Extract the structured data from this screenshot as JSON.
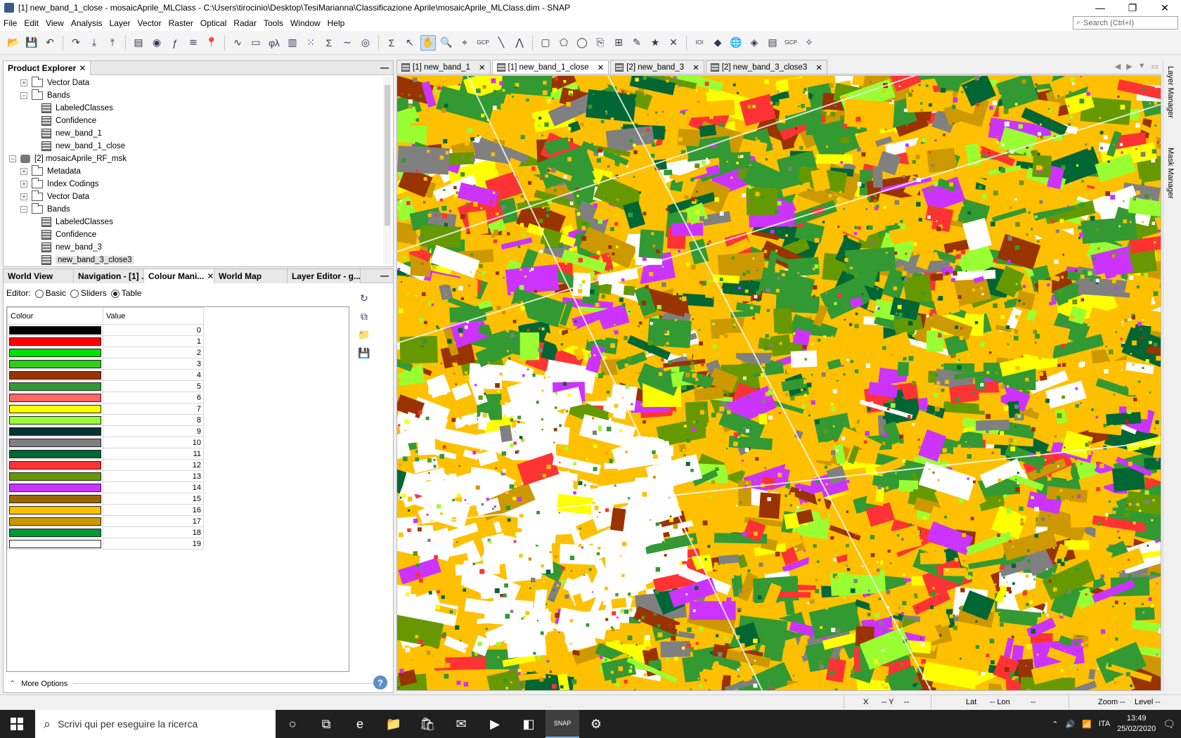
{
  "window": {
    "title": "[1] new_band_1_close - mosaicAprile_MLClass - C:\\Users\\tirocinio\\Desktop\\TesiMarianna\\Classificazione Aprile\\mosaicAprile_MLClass.dim - SNAP",
    "minimize_glyph": "—",
    "restore_glyph": "❐",
    "close_glyph": "✕"
  },
  "menu": [
    "File",
    "Edit",
    "View",
    "Analysis",
    "Layer",
    "Vector",
    "Raster",
    "Optical",
    "Radar",
    "Tools",
    "Window",
    "Help"
  ],
  "search": {
    "placeholder": "Search (Ctrl+I)"
  },
  "toolbar": {
    "icons": [
      "open-product-icon",
      "save-product-icon",
      "undo-icon",
      "redo-icon",
      "import-icon",
      "export-icon",
      "session-icon",
      "spectrum-view-icon",
      "band-maths-icon",
      "filter-icon",
      "pin-icon",
      "time-series-icon",
      "plot-icon",
      "phi-lambda-icon",
      "histogram-icon",
      "scatter-icon",
      "stats-icon",
      "profile-icon",
      "correlative-icon",
      "sum-icon",
      "select-tool-icon",
      "pan-tool-icon",
      "zoom-tool-icon",
      "range-finder-icon",
      "gcp-tool-icon",
      "line-draw-icon",
      "polyline-icon",
      "rectangle-icon",
      "polygon-icon",
      "ellipse-icon",
      "insert-icon",
      "measure-icon",
      "pencil-icon",
      "pin-place-icon",
      "xy-icon",
      "ioi-icon",
      "color-icon",
      "world-icon",
      "layers-icon",
      "stack-icon",
      "gcp-icon",
      "magic-icon"
    ],
    "glyphs": [
      "📂",
      "💾",
      "↶",
      "↷",
      "⤓",
      "⤒",
      "▤",
      "◉",
      "ƒ",
      "≋",
      "📍",
      "∿",
      "▭",
      "φλ",
      "▥",
      "⁙",
      "Σ",
      "∼",
      "◎",
      "Σ",
      "↖",
      "✋",
      "🔍",
      "⌖",
      "GCP",
      "╲",
      "⋀",
      "▢",
      "⬠",
      "◯",
      "⎘",
      "⊞",
      "✎",
      "★",
      "✕",
      "IOI",
      "◆",
      "🌐",
      "◈",
      "▤",
      "GCP",
      "✧"
    ]
  },
  "product_explorer": {
    "title": "Product Explorer",
    "close_glyph": "✕",
    "minimize_glyph": "—",
    "exp_plus": "+",
    "exp_minus": "−",
    "tree": [
      {
        "kind": "folder",
        "level": 1,
        "exp": "plus",
        "label": "Vector Data"
      },
      {
        "kind": "folder",
        "level": 1,
        "exp": "minus",
        "label": "Bands"
      },
      {
        "kind": "band",
        "level": 2,
        "label": "LabeledClasses"
      },
      {
        "kind": "band",
        "level": 2,
        "label": "Confidence"
      },
      {
        "kind": "band",
        "level": 2,
        "label": "new_band_1"
      },
      {
        "kind": "band",
        "level": 2,
        "label": "new_band_1_close"
      },
      {
        "kind": "product",
        "level": 0,
        "exp": "minus",
        "label": "[2] mosaicAprile_RF_msk"
      },
      {
        "kind": "folder",
        "level": 1,
        "exp": "plus",
        "label": "Metadata"
      },
      {
        "kind": "folder",
        "level": 1,
        "exp": "plus",
        "label": "Index Codings"
      },
      {
        "kind": "folder",
        "level": 1,
        "exp": "plus",
        "label": "Vector Data"
      },
      {
        "kind": "folder",
        "level": 1,
        "exp": "minus",
        "label": "Bands"
      },
      {
        "kind": "band",
        "level": 2,
        "label": "LabeledClasses"
      },
      {
        "kind": "band",
        "level": 2,
        "label": "Confidence"
      },
      {
        "kind": "band",
        "level": 2,
        "label": "new_band_3"
      },
      {
        "kind": "band",
        "level": 2,
        "label": "new_band_3_close3",
        "selected": true
      }
    ]
  },
  "lower_tabs": {
    "world_view": "World View",
    "navigation": "Navigation - [1] ...",
    "colour_manip": "Colour Mani...",
    "close_glyph": "✕",
    "world_map": "World Map",
    "layer_editor": "Layer Editor - g...",
    "minimize_glyph": "—"
  },
  "colour_editor": {
    "editor_label": "Editor:",
    "mode_basic": "Basic",
    "mode_sliders": "Sliders",
    "mode_table": "Table",
    "selected_mode": "Table",
    "col_colour": "Colour",
    "col_value": "Value",
    "rows": [
      {
        "color": "#000000",
        "value": "0"
      },
      {
        "color": "#ff0000",
        "value": "1"
      },
      {
        "color": "#00e000",
        "value": "2"
      },
      {
        "color": "#33cc1a",
        "value": "3"
      },
      {
        "color": "#993300",
        "value": "4"
      },
      {
        "color": "#339933",
        "value": "5"
      },
      {
        "color": "#ff6666",
        "value": "6"
      },
      {
        "color": "#ffff00",
        "value": "7"
      },
      {
        "color": "#99ff33",
        "value": "8"
      },
      {
        "color": "#003333",
        "value": "9"
      },
      {
        "color": "#808080",
        "value": "10"
      },
      {
        "color": "#006633",
        "value": "11"
      },
      {
        "color": "#ff3333",
        "value": "12"
      },
      {
        "color": "#669900",
        "value": "13"
      },
      {
        "color": "#cc33ff",
        "value": "14"
      },
      {
        "color": "#996600",
        "value": "15"
      },
      {
        "color": "#ffc000",
        "value": "16"
      },
      {
        "color": "#cc9900",
        "value": "17"
      },
      {
        "color": "#009933",
        "value": "18"
      },
      {
        "color": "#ffffff",
        "value": "19"
      }
    ],
    "more_options": "More Options",
    "more_glyph": "⌃",
    "help_glyph": "?",
    "side_glyphs": [
      "↻",
      "⧉",
      "📁",
      "💾"
    ]
  },
  "image_tabs": [
    {
      "label": "[1] new_band_1",
      "active": false
    },
    {
      "label": "[1] new_band_1_close",
      "active": true
    },
    {
      "label": "[2] new_band_3",
      "active": false
    },
    {
      "label": "[2] new_band_3_close3",
      "active": false
    }
  ],
  "image_tab_close": "✕",
  "image_tab_ctrls": [
    "◀",
    "▶",
    "▼",
    "▭"
  ],
  "right_panels": {
    "layer_manager": "Layer Manager",
    "mask_manager": "Mask Manager"
  },
  "status": {
    "x": "X",
    "x_val": "-- Y",
    "y_val": "--",
    "lat": "Lat",
    "lat_val": "-- Lon",
    "lon_val": "--",
    "zoom": "Zoom --",
    "level": "Level --"
  },
  "taskbar": {
    "search_placeholder": "Scrivi qui per eseguire la ricerca",
    "search_glyph": "⌕",
    "apps": [
      "○",
      "⧉",
      "e",
      "📁",
      "🛍",
      "✉",
      "▶",
      "◧",
      "SNAP",
      "⚙"
    ],
    "tray_glyphs": [
      "⌃",
      "🔊",
      "📶"
    ],
    "lang": "ITA",
    "time": "13:49",
    "date": "25/02/2020",
    "notif_glyph": "🗨"
  },
  "map_palette": [
    "#ffc000",
    "#ffc000",
    "#ffc000",
    "#ffff00",
    "#339933",
    "#339933",
    "#669900",
    "#99ff33",
    "#ff3333",
    "#cc33ff",
    "#808080",
    "#cc9900",
    "#ffffff",
    "#006633",
    "#993300",
    "#ffc000",
    "#339933"
  ]
}
